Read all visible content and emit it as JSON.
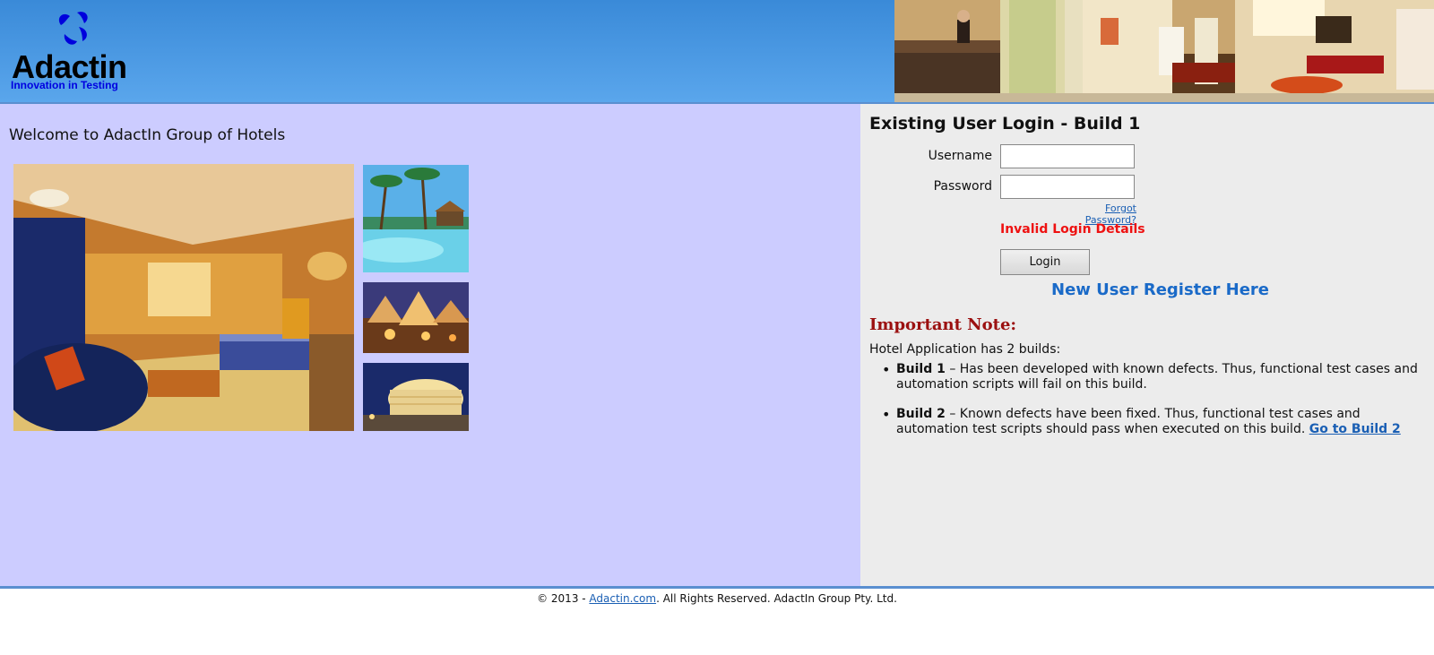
{
  "brand": {
    "name": "Adactin",
    "tagline": "Innovation in Testing",
    "logo_icon": "adactin-logo-icon",
    "logo_color": "#0000e0",
    "header_color": "#3a8ad8"
  },
  "welcome_text": "Welcome to AdactIn Group of Hotels",
  "gallery": {
    "images": [
      "hotel-lobby-banner",
      "hotel-room-photo",
      "pool-photo",
      "tents-photo",
      "hotel-night-photo"
    ]
  },
  "login": {
    "title": "Existing User Login - Build 1",
    "username_label": "Username",
    "username_value": "",
    "password_label": "Password",
    "password_value": "",
    "forgot_password": "Forgot Password?",
    "error_message": "Invalid Login Details",
    "error_color": "#ee1111",
    "login_button": "Login",
    "register_link": "New User Register Here"
  },
  "note": {
    "title": "Important Note:",
    "intro": "Hotel Application has 2 builds:",
    "builds": [
      {
        "name": "Build 1",
        "text": " – Has been developed with known defects. Thus, functional test cases and automation scripts will fail on this build."
      },
      {
        "name": "Build 2",
        "text": " – Known defects have been fixed. Thus, functional test cases and automation test scripts should pass when executed on this build. ",
        "link": "Go to Build 2"
      }
    ]
  },
  "footer": {
    "prefix": "© 2013 - ",
    "link": "Adactin.com",
    "suffix": ". All Rights Reserved. AdactIn Group Pty. Ltd."
  }
}
